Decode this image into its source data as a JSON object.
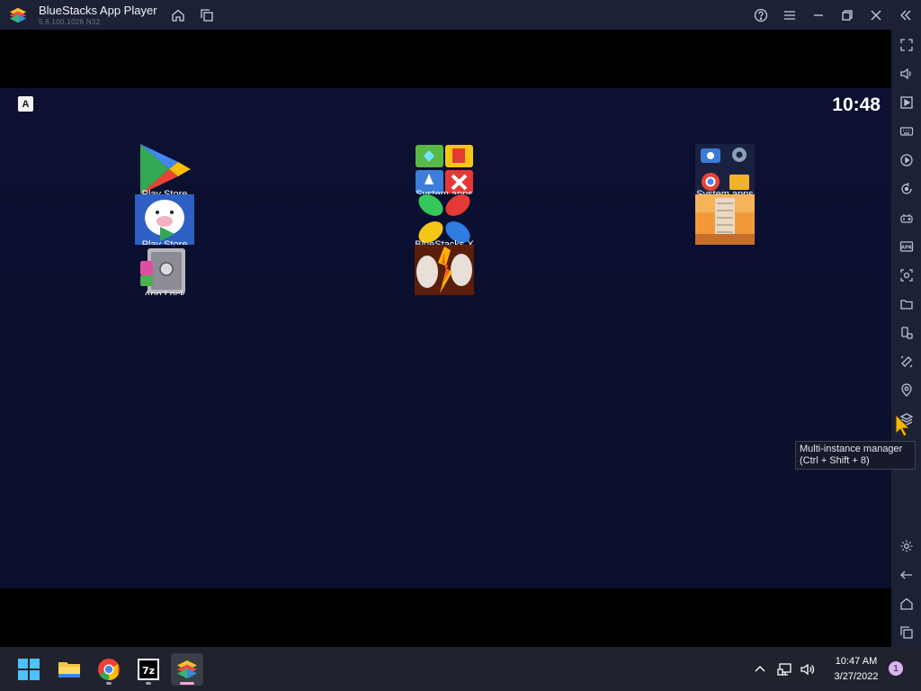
{
  "window": {
    "title": "BlueStacks App Player",
    "version": "5.6.100.1026  N32"
  },
  "titlebar_buttons": [
    "home-icon",
    "multi-window-icon",
    "help-icon",
    "menu-icon",
    "minimize-icon",
    "restore-icon",
    "close-icon",
    "collapse-sidebar-icon"
  ],
  "sidebar_buttons": [
    "fullscreen-icon",
    "volume-icon",
    "screen-record-icon",
    "keyboard-icon",
    "macro-icon",
    "sync-icon",
    "gamepad-icon",
    "apk-icon",
    "screenshot-icon",
    "folder-icon",
    "rotate-icon",
    "shake-icon",
    "location-icon",
    "multi-instance-icon",
    "settings-icon",
    "back-icon",
    "home-icon",
    "recents-icon"
  ],
  "android": {
    "status_icon": "A",
    "clock": "10:48",
    "apps": [
      {
        "label": "Play Store",
        "icon": "play-store-icon"
      },
      {
        "label": "System apps",
        "icon": "game-folder-icon"
      },
      {
        "label": "System apps",
        "icon": "system-apps-folder-icon"
      },
      {
        "label": "Play Store",
        "icon": "pig-app-icon"
      },
      {
        "label": "BlueStacks X",
        "icon": "bluestacks-x-icon"
      },
      {
        "label": "",
        "icon": "building-app-icon"
      },
      {
        "label": "App Lock",
        "icon": "app-lock-icon"
      },
      {
        "label": "",
        "icon": "fire-app-icon"
      }
    ]
  },
  "tooltip": {
    "line1": "Multi-instance manager",
    "line2": "(Ctrl + Shift + 8)"
  },
  "taskbar": {
    "apps": [
      "windows-start-icon",
      "file-explorer-icon",
      "chrome-icon",
      "7zip-icon",
      "bluestacks-icon"
    ],
    "time": "10:47 AM",
    "date": "3/27/2022",
    "notifications": "1"
  }
}
